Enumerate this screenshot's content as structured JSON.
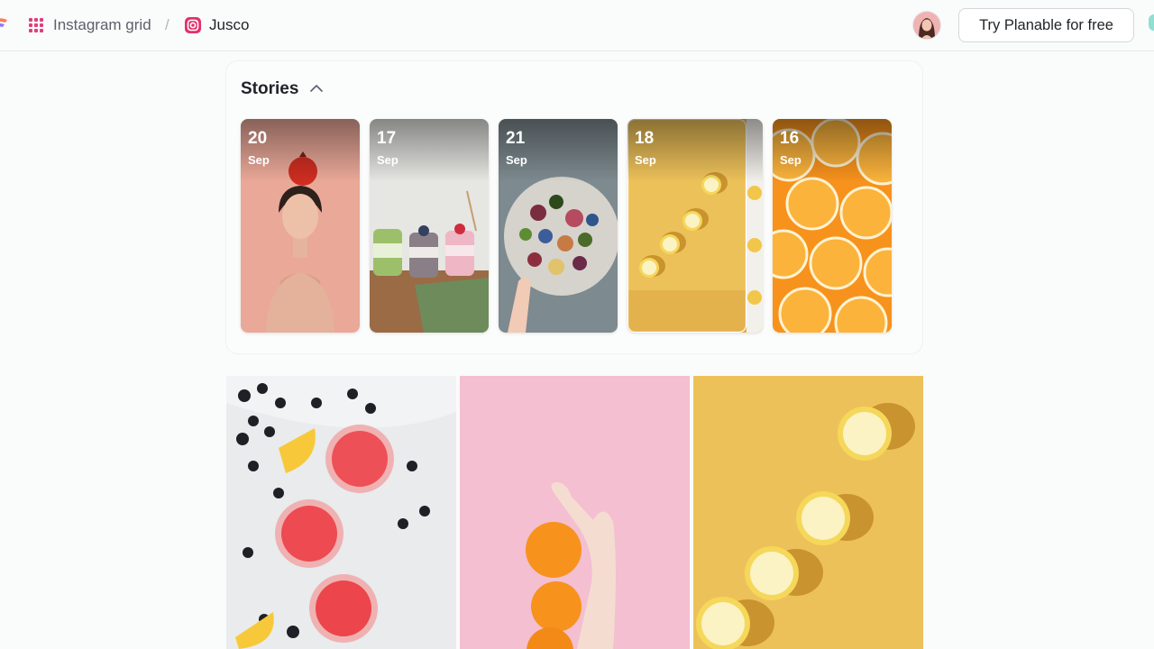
{
  "breadcrumb": {
    "grid_label": "Instagram grid",
    "separator": "/",
    "profile_label": "Jusco"
  },
  "header": {
    "cta_label": "Try Planable for free"
  },
  "stories": {
    "title": "Stories",
    "items": [
      {
        "day": "20",
        "month": "Sep",
        "subject": "woman with pomegranate on head"
      },
      {
        "day": "17",
        "month": "Sep",
        "subject": "layered parfait jars"
      },
      {
        "day": "21",
        "month": "Sep",
        "subject": "fruit platter"
      },
      {
        "day": "18",
        "month": "Sep",
        "subject": "lemon slices on yellow"
      },
      {
        "day": "16",
        "month": "Sep",
        "subject": "orange slices"
      }
    ]
  },
  "feed": {
    "tiles": [
      {
        "subject": "red drinks with blackberries and lemon"
      },
      {
        "subject": "hand with oranges on pink"
      },
      {
        "subject": "lemon slices on yellow"
      }
    ]
  },
  "colors": {
    "background": "#fafbfb",
    "brand_pink": "#e23d7d",
    "instagram_icon": "#e1306c",
    "story_yellow": "#edc159",
    "tile_pink": "#f3bfd1",
    "orange": "#f7921c"
  }
}
